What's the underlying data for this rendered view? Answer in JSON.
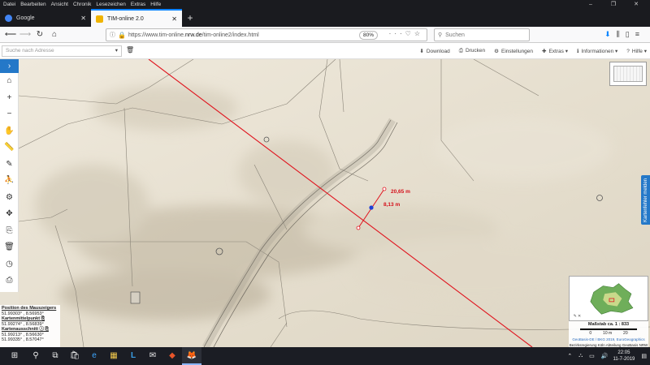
{
  "menu": [
    "Datei",
    "Bearbeiten",
    "Ansicht",
    "Chronik",
    "Lesezeichen",
    "Extras",
    "Hilfe"
  ],
  "window_controls": [
    "–",
    "❐",
    "✕"
  ],
  "tabs": [
    {
      "title": "Google",
      "favicon_color": "#4285f4"
    },
    {
      "title": "TIM-online 2.0",
      "favicon_color": "#f0b400"
    }
  ],
  "new_tab": "+",
  "url": {
    "prefix": "https://www.tim-online.",
    "domain": "nrw.de",
    "suffix": "/tim-online2/index.html"
  },
  "zoom": "80%",
  "search_placeholder": "Suchen",
  "address_placeholder": "Suche nach Adresse",
  "app_buttons": [
    {
      "icon": "⬇",
      "label": "Download"
    },
    {
      "icon": "⎙",
      "label": "Drucken"
    },
    {
      "icon": "⚙",
      "label": "Einstellungen"
    },
    {
      "icon": "✚",
      "label": "Extras"
    },
    {
      "icon": "ℹ",
      "label": "Informationen"
    },
    {
      "icon": "?",
      "label": "Hilfe"
    }
  ],
  "tools": [
    "⌂",
    "+",
    "−",
    "✋",
    "📏",
    "✎",
    "⛹",
    "⚙",
    "✥",
    "⎘",
    "🗑",
    "◷",
    "⎙"
  ],
  "measurements": {
    "distance_1": "20,65 m",
    "distance_2": "8,13 m"
  },
  "side_tab": "Kartenfehler melden",
  "coords": {
    "mouse_title": "Position des Mauszeigers",
    "mouse_value": "51.99303° , 8.56953°",
    "center_title": "Kartenmittelpunkt",
    "center_value": "51.99274° , 8.56839°",
    "extent_title": "Kartenausschnitt",
    "extent_value_1": "51.99213° , 8.56630°",
    "extent_value_2": "51.99335° , 8.57047°"
  },
  "scale": {
    "title": "Maßstab ca. 1 : 833",
    "ticks": "0          10 m          20",
    "attribution_1": "GeoBasis-DE / BKG 2019, EuroGeographics",
    "attribution_2": "Bezirksregierung Köln Abteilung GeoBasis NRW"
  },
  "taskbar": {
    "time": "22:05",
    "date": "11-7-2019",
    "icons": [
      "⊞",
      "⚲",
      "⧉",
      "🛍",
      "e",
      "▦",
      "L",
      "✉",
      "◆",
      "🦊"
    ],
    "tray_icons": [
      "⌃",
      "⛬",
      "▭",
      "🔊",
      "▤"
    ]
  },
  "colors": {
    "accent": "#2478c8",
    "measure_line": "#e0141e"
  }
}
